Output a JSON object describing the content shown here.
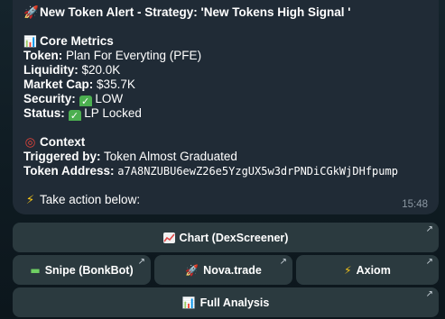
{
  "message": {
    "title_icon": "rocket-icon",
    "title": "New Token Alert - Strategy: 'New Tokens High Signal '",
    "metrics_icon": "bar-chart-icon",
    "metrics_heading": "Core Metrics",
    "token_label": "Token:",
    "token_value": "Plan For Everyting (PFE)",
    "liquidity_label": "Liquidity:",
    "liquidity_value": "$20.0K",
    "market_cap_label": "Market Cap:",
    "market_cap_value": "$35.7K",
    "security_label": "Security:",
    "security_value": "LOW",
    "status_label": "Status:",
    "status_value": "LP Locked",
    "context_icon": "target-icon",
    "context_heading": "Context",
    "triggered_label": "Triggered by:",
    "triggered_value": "Token Almost Graduated",
    "address_label": "Token Address:",
    "address_value": "a7A8NZUBU6ewZ26e5YzgUX5w3drPNDiCGkWjDHfpump",
    "action_icon": "lightning-icon",
    "action_text": "Take action below:",
    "time": "15:48"
  },
  "buttons": {
    "chart_label": "Chart (DexScreener)",
    "snipe_label": "Snipe (BonkBot)",
    "nova_label": "Nova.trade",
    "axiom_label": "Axiom",
    "analysis_label": "Full Analysis"
  },
  "colors": {
    "bubble": "#202b36",
    "button": "#2b3a3f",
    "check": "#4caf50",
    "time": "#8c98a3"
  }
}
